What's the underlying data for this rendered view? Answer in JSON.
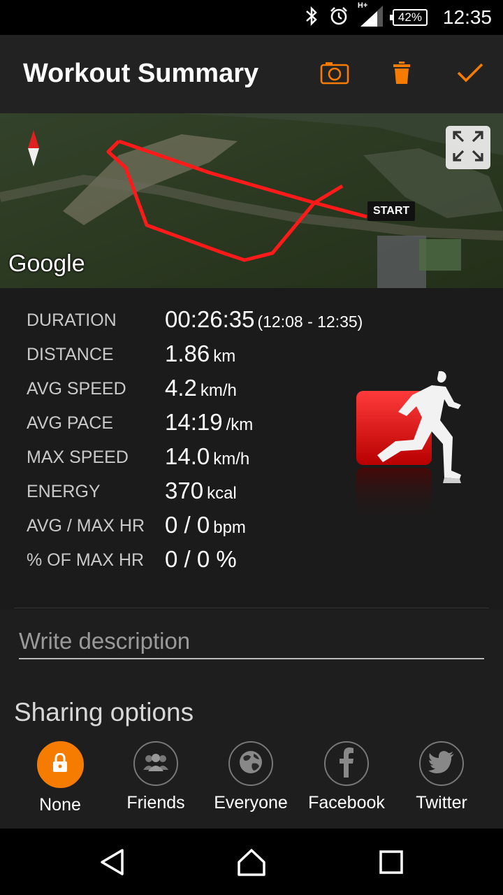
{
  "status_bar": {
    "time": "12:35",
    "battery": "42%",
    "network": "H+"
  },
  "toolbar": {
    "title": "Workout Summary",
    "camera_icon": "camera-icon",
    "delete_icon": "trash-icon",
    "confirm_icon": "checkmark-icon",
    "accent": "#f57c00"
  },
  "map": {
    "google_label": "Google",
    "start_label": "START",
    "route_color": "#ff1a1a"
  },
  "stats": [
    {
      "label": "DURATION",
      "value": "00:26:35",
      "unit": "",
      "extra": "(12:08 - 12:35)"
    },
    {
      "label": "DISTANCE",
      "value": "1.86",
      "unit": "km",
      "extra": ""
    },
    {
      "label": "AVG SPEED",
      "value": "4.2",
      "unit": "km/h",
      "extra": ""
    },
    {
      "label": "AVG PACE",
      "value": "14:19",
      "unit": "/km",
      "extra": ""
    },
    {
      "label": "MAX SPEED",
      "value": "14.0",
      "unit": "km/h",
      "extra": ""
    },
    {
      "label": "ENERGY",
      "value": "370",
      "unit": "kcal",
      "extra": ""
    },
    {
      "label": "AVG / MAX HR",
      "value": "0 / 0",
      "unit": "bpm",
      "extra": ""
    },
    {
      "label": "% OF MAX HR",
      "value": "0 / 0 %",
      "unit": "",
      "extra": ""
    }
  ],
  "description": {
    "placeholder": "Write description",
    "value": ""
  },
  "sharing": {
    "title": "Sharing options",
    "selected": "None",
    "options": [
      {
        "label": "None",
        "icon": "lock-icon"
      },
      {
        "label": "Friends",
        "icon": "friends-icon"
      },
      {
        "label": "Everyone",
        "icon": "globe-icon"
      },
      {
        "label": "Facebook",
        "icon": "facebook-icon"
      },
      {
        "label": "Twitter",
        "icon": "twitter-icon"
      }
    ]
  },
  "nav": {
    "back_icon": "back-icon",
    "home_icon": "home-icon",
    "recents_icon": "recents-icon"
  }
}
